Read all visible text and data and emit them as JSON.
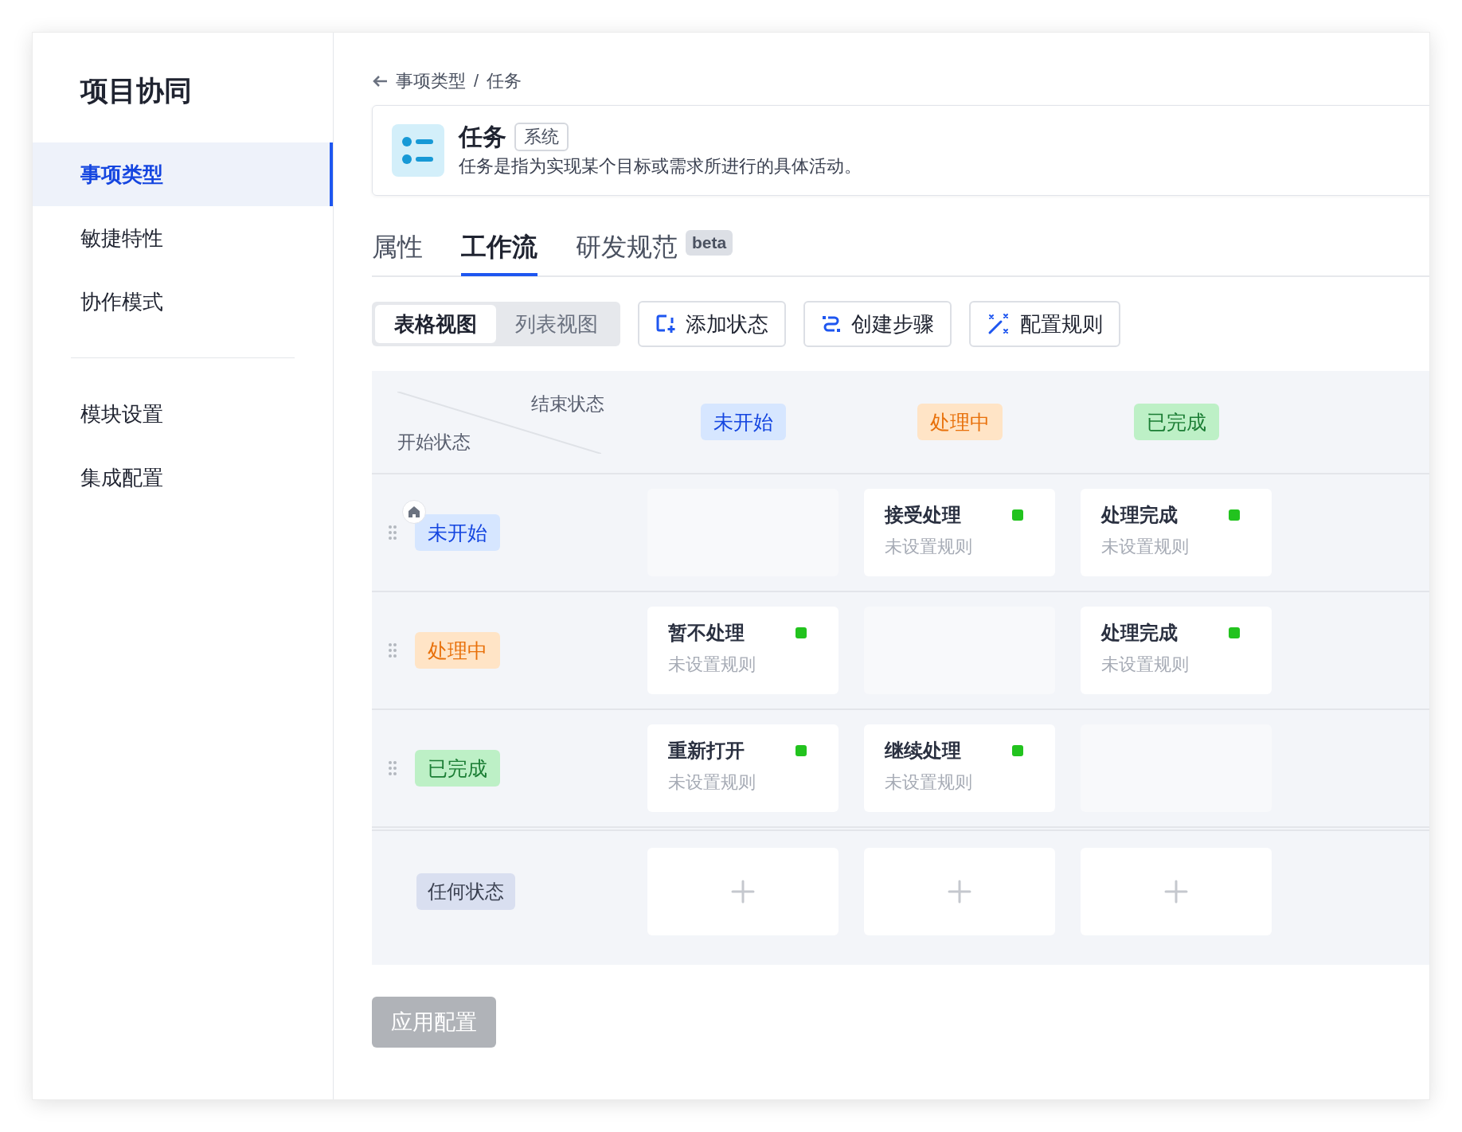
{
  "sidebar": {
    "title": "项目协同",
    "groups": [
      [
        {
          "label": "事项类型",
          "selected": true
        },
        {
          "label": "敏捷特性",
          "selected": false
        },
        {
          "label": "协作模式",
          "selected": false
        }
      ],
      [
        {
          "label": "模块设置",
          "selected": false
        },
        {
          "label": "集成配置",
          "selected": false
        }
      ]
    ]
  },
  "breadcrumb": {
    "items": [
      "事项类型",
      "任务"
    ],
    "separator": "/"
  },
  "type_card": {
    "title": "任务",
    "badge": "系统",
    "description": "任务是指为实现某个目标或需求所进行的具体活动。"
  },
  "tabs": [
    {
      "label": "属性",
      "selected": false
    },
    {
      "label": "工作流",
      "selected": true
    },
    {
      "label": "研发规范",
      "selected": false,
      "badge": "beta"
    }
  ],
  "view_toggle": [
    {
      "label": "表格视图",
      "selected": true
    },
    {
      "label": "列表视图",
      "selected": false
    }
  ],
  "toolbar": [
    {
      "label": "添加状态",
      "kind": "add"
    },
    {
      "label": "创建步骤",
      "kind": "step"
    },
    {
      "label": "配置规则",
      "kind": "rule"
    }
  ],
  "matrix": {
    "corner": {
      "end_label": "结束状态",
      "start_label": "开始状态"
    },
    "columns": [
      {
        "label": "未开始",
        "kind": "todo"
      },
      {
        "label": "处理中",
        "kind": "doing"
      },
      {
        "label": "已完成",
        "kind": "done"
      }
    ],
    "rows": [
      {
        "label": "未开始",
        "kind": "todo",
        "initial": true,
        "cells": [
          {
            "kind": "empty"
          },
          {
            "kind": "transition",
            "name": "接受处理",
            "rule": "未设置规则",
            "color": "#22c31e"
          },
          {
            "kind": "transition",
            "name": "处理完成",
            "rule": "未设置规则",
            "color": "#22c31e"
          }
        ]
      },
      {
        "label": "处理中",
        "kind": "doing",
        "initial": false,
        "cells": [
          {
            "kind": "transition",
            "name": "暂不处理",
            "rule": "未设置规则",
            "color": "#22c31e"
          },
          {
            "kind": "empty"
          },
          {
            "kind": "transition",
            "name": "处理完成",
            "rule": "未设置规则",
            "color": "#22c31e"
          }
        ]
      },
      {
        "label": "已完成",
        "kind": "done",
        "initial": false,
        "cells": [
          {
            "kind": "transition",
            "name": "重新打开",
            "rule": "未设置规则",
            "color": "#22c31e"
          },
          {
            "kind": "transition",
            "name": "继续处理",
            "rule": "未设置规则",
            "color": "#22c31e"
          },
          {
            "kind": "empty"
          }
        ]
      }
    ],
    "any_row": {
      "label": "任何状态",
      "cells": [
        {
          "kind": "add"
        },
        {
          "kind": "add"
        },
        {
          "kind": "add"
        }
      ]
    }
  },
  "apply_button": {
    "label": "应用配置",
    "disabled": true
  }
}
